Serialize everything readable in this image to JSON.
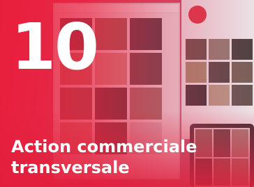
{
  "card": {
    "number": "10",
    "title_line1": "Action commerciale",
    "title_line2": "transversale"
  },
  "colors": {
    "accent": "#e8203f",
    "text": "#ffffff"
  }
}
